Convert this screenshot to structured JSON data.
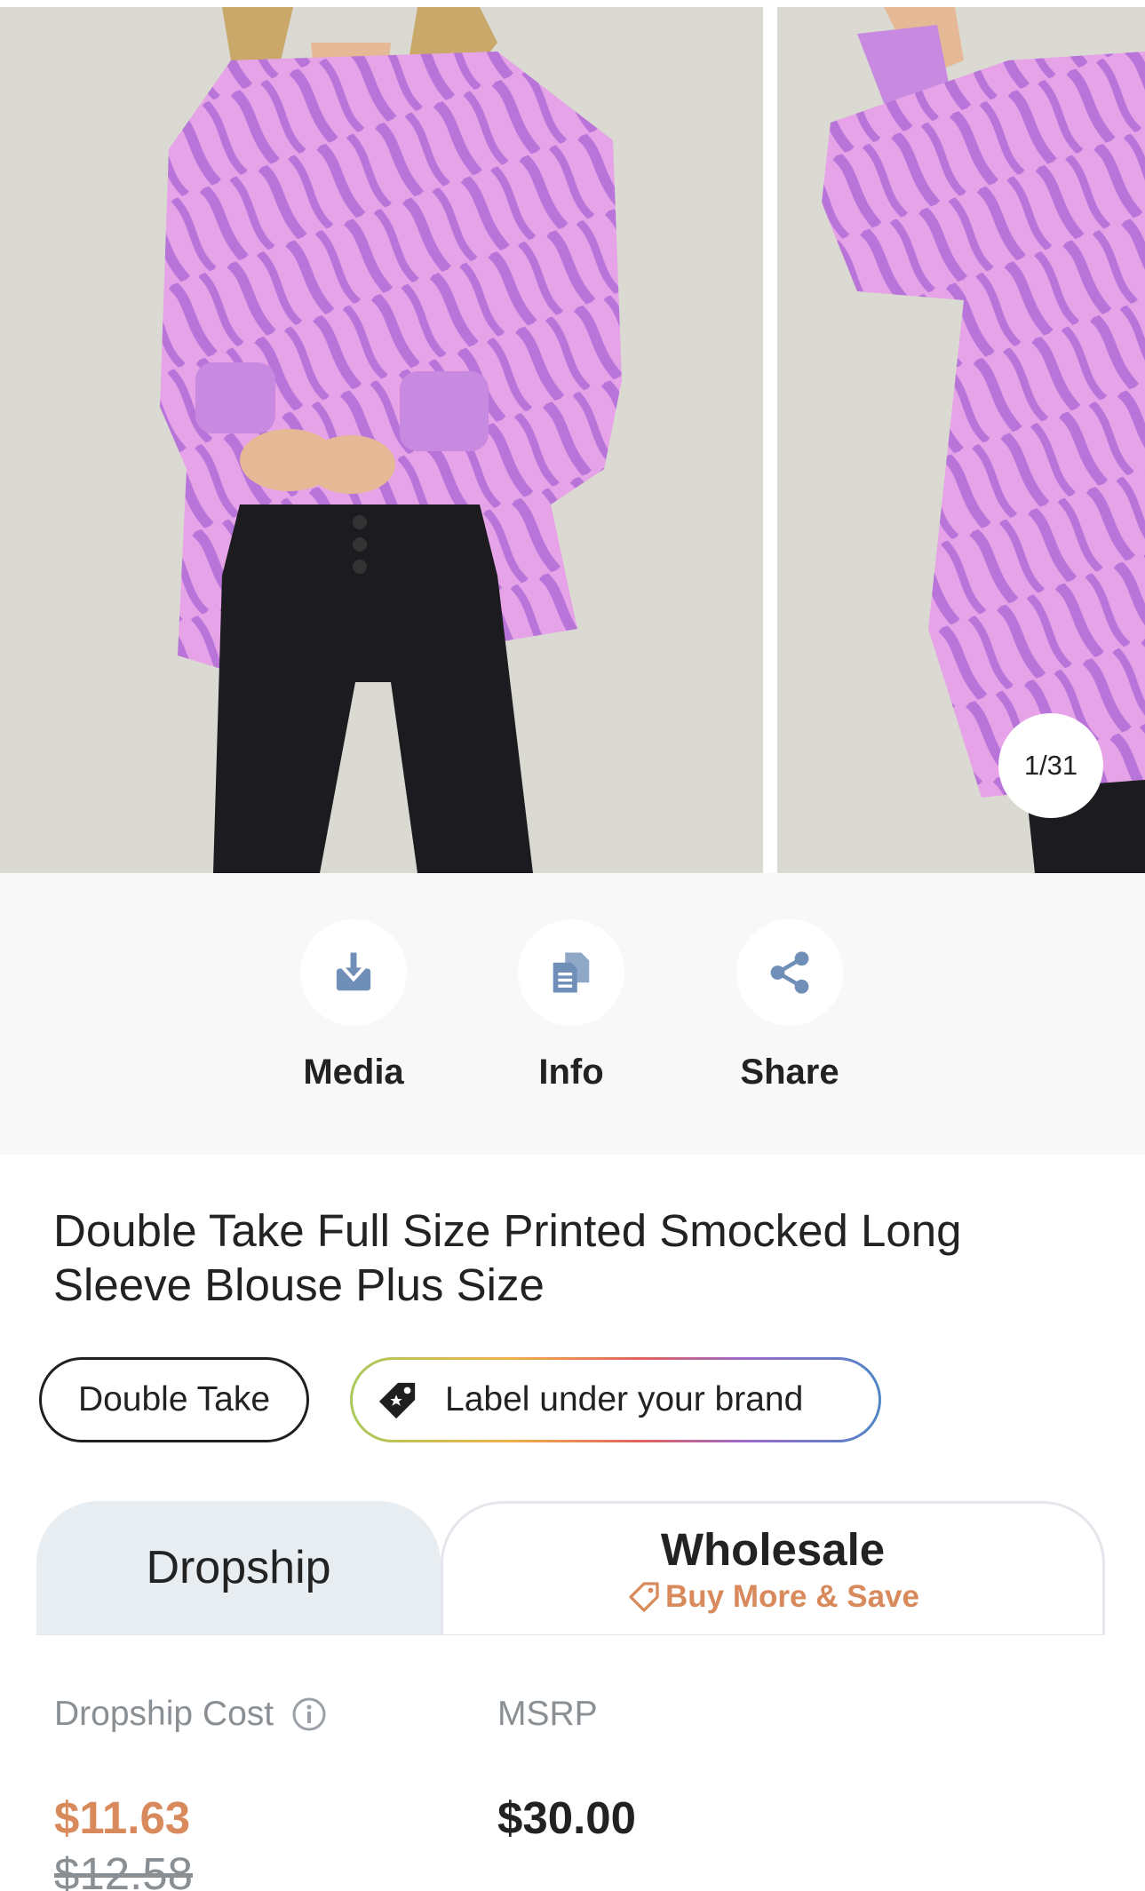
{
  "gallery": {
    "counter": "1/31"
  },
  "actions": {
    "media_label": "Media",
    "info_label": "Info",
    "share_label": "Share"
  },
  "product": {
    "title": "Double Take Full Size Printed Smocked Long Sleeve Blouse Plus Size",
    "brand_tag": "Double Take",
    "label_tag": "Label under your brand"
  },
  "tabs": {
    "dropship_label": "Dropship",
    "wholesale_label": "Wholesale",
    "wholesale_sub": "Buy More & Save"
  },
  "pricing": {
    "dropship_cost_label": "Dropship Cost",
    "dropship_price": "$11.63",
    "dropship_old_price": "$12.58",
    "msrp_label": "MSRP",
    "msrp_price": "$30.00"
  },
  "colors": {
    "accent_orange": "#d98a5c",
    "icon_blue": "#6f8fb8",
    "blouse_pink": "#e6a3e8",
    "blouse_stripe": "#b874d9",
    "pants_black": "#1c1b1f"
  },
  "icons": [
    "download-icon",
    "document-copy-icon",
    "share-icon",
    "price-tag-icon",
    "info-icon"
  ]
}
